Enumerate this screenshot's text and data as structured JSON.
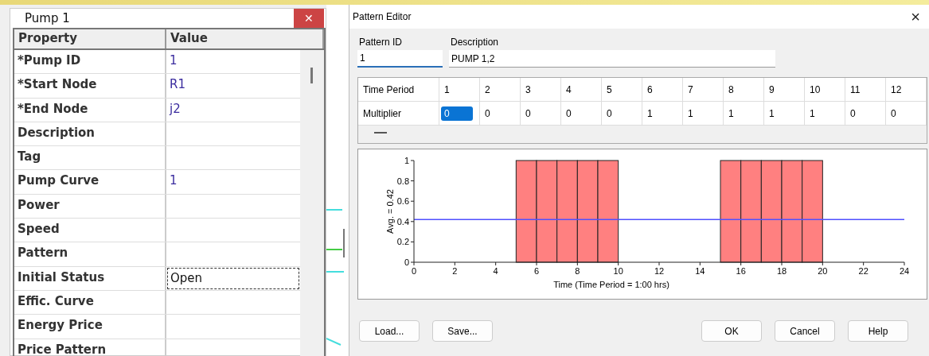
{
  "property_window": {
    "title": "Pump 1",
    "close": "✕",
    "columns": [
      "Property",
      "Value"
    ],
    "rows": [
      {
        "property": "*Pump ID",
        "value": "1",
        "selected": false
      },
      {
        "property": "*Start Node",
        "value": "R1",
        "selected": false
      },
      {
        "property": "*End Node",
        "value": "j2",
        "selected": false
      },
      {
        "property": "Description",
        "value": "",
        "selected": false
      },
      {
        "property": "Tag",
        "value": "",
        "selected": false
      },
      {
        "property": "Pump Curve",
        "value": "1",
        "selected": false
      },
      {
        "property": "Power",
        "value": "",
        "selected": false
      },
      {
        "property": "Speed",
        "value": "",
        "selected": false
      },
      {
        "property": "Pattern",
        "value": "",
        "selected": false
      },
      {
        "property": "Initial Status",
        "value": "Open",
        "selected": true
      },
      {
        "property": "Effic. Curve",
        "value": "",
        "selected": false
      },
      {
        "property": "Energy Price",
        "value": "",
        "selected": false
      },
      {
        "property": "Price Pattern",
        "value": "",
        "selected": false
      }
    ]
  },
  "pattern_editor": {
    "title": "Pattern Editor",
    "close": "×",
    "pattern_id": {
      "label": "Pattern ID",
      "value": "1"
    },
    "description": {
      "label": "Description",
      "value": "PUMP 1,2"
    },
    "table": {
      "row_labels": [
        "Time Period",
        "Multiplier"
      ],
      "periods": [
        {
          "period": "1",
          "multiplier": "0",
          "selected": true
        },
        {
          "period": "2",
          "multiplier": "0",
          "selected": false
        },
        {
          "period": "3",
          "multiplier": "0",
          "selected": false
        },
        {
          "period": "4",
          "multiplier": "0",
          "selected": false
        },
        {
          "period": "5",
          "multiplier": "0",
          "selected": false
        },
        {
          "period": "6",
          "multiplier": "1",
          "selected": false
        },
        {
          "period": "7",
          "multiplier": "1",
          "selected": false
        },
        {
          "period": "8",
          "multiplier": "1",
          "selected": false
        },
        {
          "period": "9",
          "multiplier": "1",
          "selected": false
        },
        {
          "period": "10",
          "multiplier": "1",
          "selected": false
        },
        {
          "period": "11",
          "multiplier": "0",
          "selected": false
        },
        {
          "period": "12",
          "multiplier": "0",
          "selected": false
        }
      ]
    },
    "chart_data": {
      "type": "bar",
      "xlabel": "Time (Time Period = 1:00 hrs)",
      "ylabel": "Avg. = 0.42",
      "x": [
        0.5,
        1.5,
        2.5,
        3.5,
        4.5,
        5.5,
        6.5,
        7.5,
        8.5,
        9.5,
        10.5,
        11.5,
        12.5,
        13.5,
        14.5,
        15.5,
        16.5,
        17.5,
        18.5,
        19.5,
        20.5,
        21.5,
        22.5,
        23.5
      ],
      "series": [
        {
          "color": "#ff8080",
          "values": [
            0,
            0,
            0,
            0,
            0,
            1,
            1,
            1,
            1,
            1,
            0,
            0,
            0,
            0,
            0,
            1,
            1,
            1,
            1,
            1,
            0,
            0,
            0,
            0
          ]
        }
      ],
      "xlim": [
        0,
        24
      ],
      "ylim": [
        0,
        1
      ],
      "xticks": [
        0,
        2,
        4,
        6,
        8,
        10,
        12,
        14,
        16,
        18,
        20,
        22,
        24
      ],
      "yticks": [
        0,
        0.2,
        0.4,
        0.6,
        0.8,
        1
      ],
      "ref_lines": [
        {
          "axis": "y",
          "value": 0.42,
          "color": "#5050ff"
        }
      ]
    },
    "buttons": [
      "Load...",
      "Save...",
      "OK",
      "Cancel",
      "Help"
    ]
  }
}
